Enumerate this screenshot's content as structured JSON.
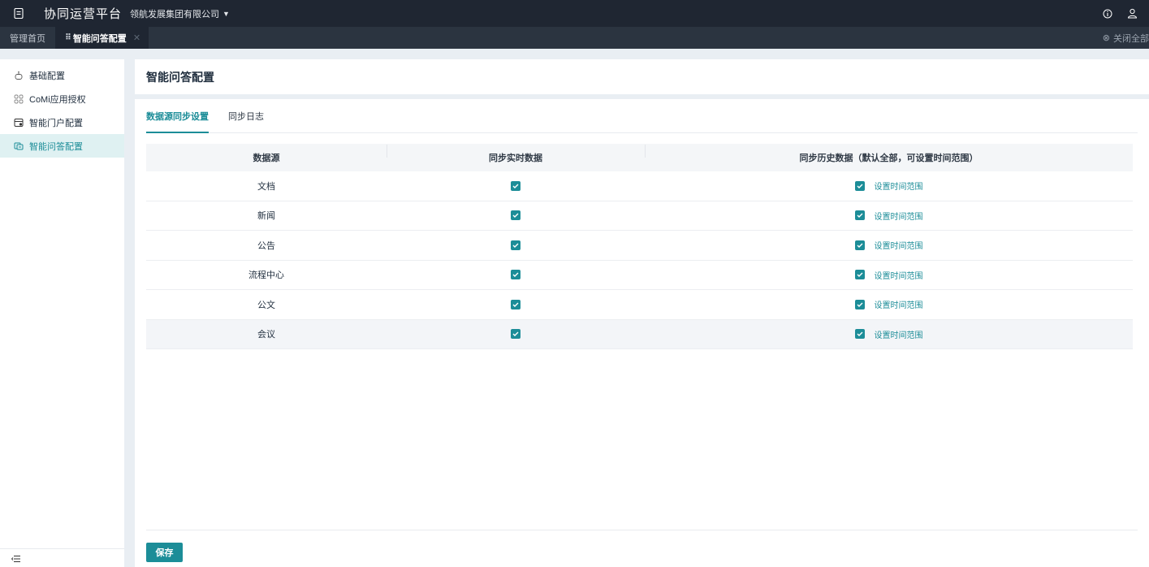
{
  "topbar": {
    "app_title": "协同运营平台",
    "org_name": "领航发展集团有限公司",
    "icons": [
      "doc-icon",
      "info-icon",
      "user-icon"
    ]
  },
  "tabbar": {
    "tabs": [
      {
        "label": "管理首页",
        "active": false
      },
      {
        "label": "智能问答配置",
        "active": true
      }
    ],
    "close_all": "关闭全部"
  },
  "sidebar": {
    "items": [
      {
        "label": "基础配置",
        "icon": "robot-icon",
        "active": false
      },
      {
        "label": "CoMi应用授权",
        "icon": "grid-icon",
        "active": false
      },
      {
        "label": "智能门户配置",
        "icon": "portal-icon",
        "active": false
      },
      {
        "label": "智能问答配置",
        "icon": "qa-icon",
        "active": true
      }
    ]
  },
  "page": {
    "title": "智能问答配置",
    "tabs": [
      {
        "label": "数据源同步设置",
        "active": true
      },
      {
        "label": "同步日志",
        "active": false
      }
    ],
    "table": {
      "headers": [
        "数据源",
        "同步实时数据",
        "同步历史数据（默认全部，可设置时间范围）"
      ],
      "rows": [
        {
          "source": "文档",
          "realtime": true,
          "history": true,
          "link": "设置时间范围"
        },
        {
          "source": "新闻",
          "realtime": true,
          "history": true,
          "link": "设置时间范围"
        },
        {
          "source": "公告",
          "realtime": true,
          "history": true,
          "link": "设置时间范围"
        },
        {
          "source": "流程中心",
          "realtime": true,
          "history": true,
          "link": "设置时间范围"
        },
        {
          "source": "公文",
          "realtime": true,
          "history": true,
          "link": "设置时间范围"
        },
        {
          "source": "会议",
          "realtime": true,
          "history": true,
          "link": "设置时间范围"
        }
      ]
    },
    "save_label": "保存"
  },
  "colors": {
    "accent": "#1c8d98",
    "topbar_bg": "#1f2632",
    "tabbar_bg": "#2b3440",
    "sidebar_active_bg": "#dff1f2"
  }
}
